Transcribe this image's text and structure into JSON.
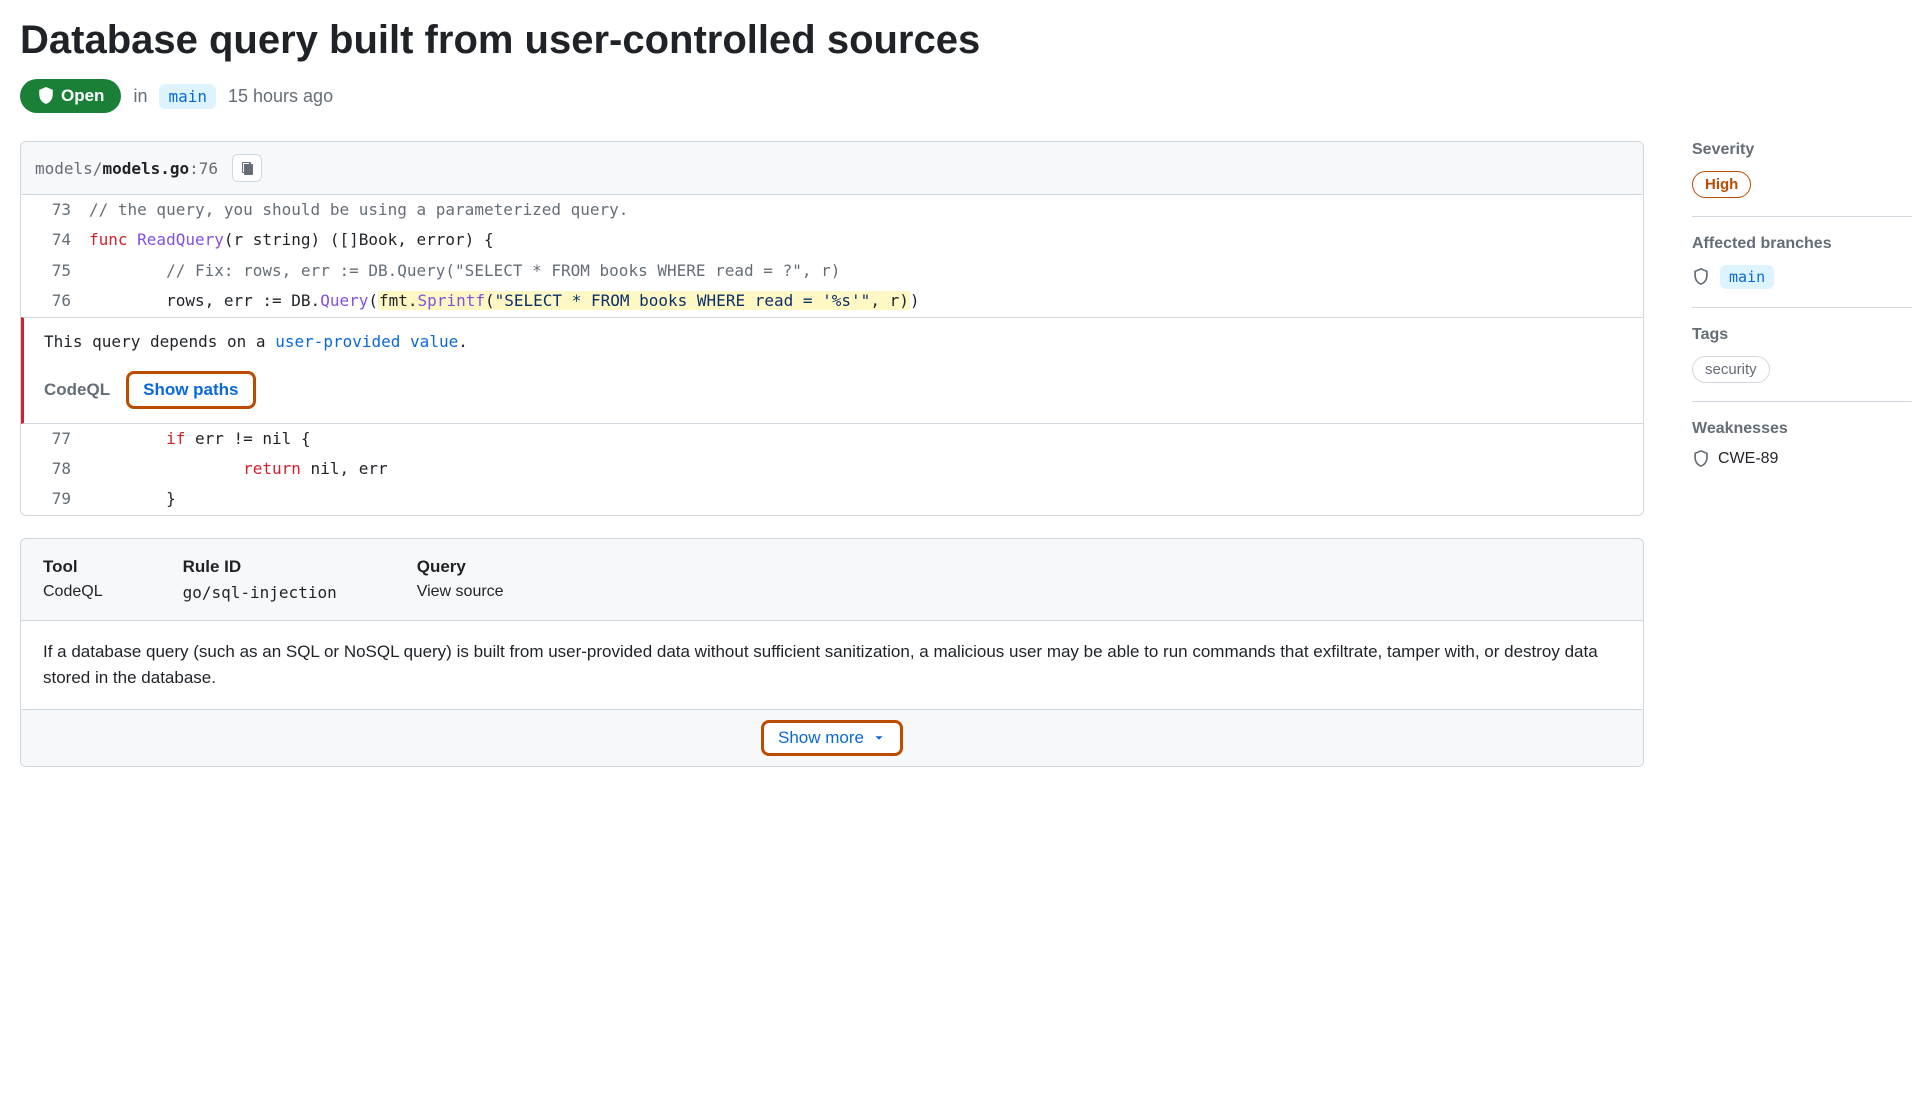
{
  "header": {
    "title": "Database query built from user-controlled sources",
    "status": "Open",
    "in_label": "in",
    "branch": "main",
    "age": "15 hours ago"
  },
  "code_panel": {
    "path_prefix": "models/",
    "file": "models.go",
    "line_ref": ":76",
    "lines": {
      "l73_no": "73",
      "l73_comment": "// the query, you should be using a parameterized query.",
      "l74_no": "74",
      "l74_kw": "func",
      "l74_name": " ReadQuery",
      "l74_sig": "(r string) ([]Book, error) {",
      "l75_no": "75",
      "l75_comment": "        // Fix: rows, err := DB.Query(\"SELECT * FROM books WHERE read = ?\", r)",
      "l76_no": "76",
      "l76_a": "        rows, err := DB.",
      "l76_query": "Query",
      "l76_b": "(",
      "l76_fmt": "fmt",
      "l76_dot": ".",
      "l76_sprintf": "Sprintf",
      "l76_c": "(",
      "l76_str": "\"SELECT * FROM books WHERE read = '%s'\"",
      "l76_d": ", r)",
      "l76_e": ")",
      "l77_no": "77",
      "l77_a": "        ",
      "l77_if": "if",
      "l77_b": " err != nil {",
      "l78_no": "78",
      "l78_a": "                ",
      "l78_ret": "return",
      "l78_b": " nil, err",
      "l79_no": "79",
      "l79_a": "        }"
    },
    "alert": {
      "msg_pre": "This query depends on a ",
      "msg_link": "user-provided value",
      "msg_post": ".",
      "tool": "CodeQL",
      "show_paths": "Show paths"
    }
  },
  "meta": {
    "tool_h": "Tool",
    "tool_v": "CodeQL",
    "rule_h": "Rule ID",
    "rule_v": "go/sql-injection",
    "query_h": "Query",
    "query_v": "View source",
    "description": "If a database query (such as an SQL or NoSQL query) is built from user-provided data without sufficient sanitization, a malicious user may be able to run commands that exfiltrate, tamper with, or destroy data stored in the database.",
    "show_more": "Show more"
  },
  "sidebar": {
    "severity_h": "Severity",
    "severity_v": "High",
    "branches_h": "Affected branches",
    "branch": "main",
    "tags_h": "Tags",
    "tag": "security",
    "weak_h": "Weaknesses",
    "weak_v": "CWE-89"
  }
}
